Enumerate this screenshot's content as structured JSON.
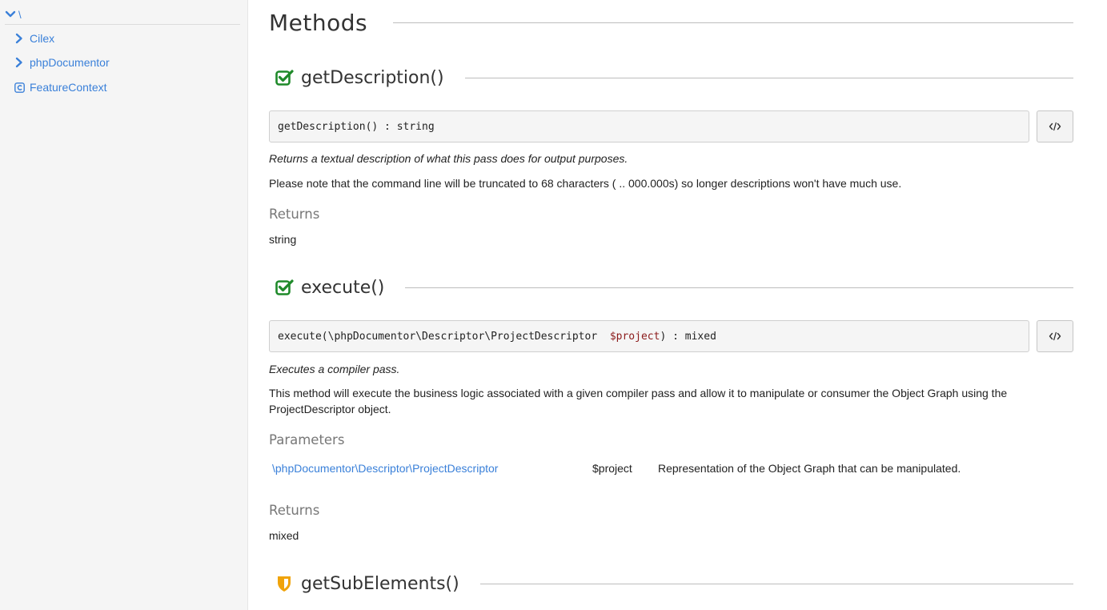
{
  "sidebar": {
    "root_label": "\\",
    "items": [
      {
        "label": "Cilex",
        "icon": "chevron-right-icon"
      },
      {
        "label": "phpDocumentor",
        "icon": "chevron-right-icon"
      },
      {
        "label": "FeatureContext",
        "icon": "class-icon"
      }
    ]
  },
  "main": {
    "section_title": "Methods",
    "methods": [
      {
        "name": "getDescription()",
        "status_icon": "check-square-icon",
        "signature": "getDescription() : string",
        "summary": "Returns a textual description of what this pass does for output purposes.",
        "description": "Please note that the command line will be truncated to 68 characters ( .. 000.000s) so longer descriptions won't have much use.",
        "returns_heading": "Returns",
        "returns": "string"
      },
      {
        "name": "execute()",
        "status_icon": "check-square-icon",
        "signature_prefix": "execute(\\phpDocumentor\\Descriptor\\ProjectDescriptor  ",
        "signature_var": "$project",
        "signature_suffix": ") : mixed",
        "summary": "Executes a compiler pass.",
        "description": "This method will execute the business logic associated with a given compiler pass and allow it to manipulate or consumer the Object Graph using the ProjectDescriptor object.",
        "parameters_heading": "Parameters",
        "parameters": [
          {
            "type": "\\phpDocumentor\\Descriptor\\ProjectDescriptor",
            "name": "$project",
            "description": "Representation of the Object Graph that can be manipulated."
          }
        ],
        "returns_heading": "Returns",
        "returns": "mixed"
      },
      {
        "name": "getSubElements()",
        "status_icon": "shield-icon"
      }
    ]
  },
  "colors": {
    "link": "#3a80d9",
    "check": "#1f8a2a",
    "shield": "#f0a30a",
    "variable": "#8b1a1a"
  }
}
